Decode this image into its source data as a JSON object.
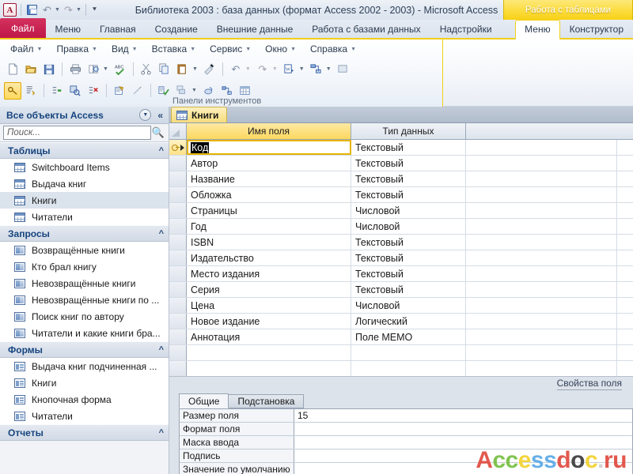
{
  "window": {
    "title": "Библиотека 2003 : база данных (формат Access 2002 - 2003)  -  Microsoft Access",
    "logo_text": "A"
  },
  "quick_access": {
    "items": [
      {
        "name": "save-icon",
        "label": ""
      },
      {
        "name": "undo-icon",
        "label": "↶"
      },
      {
        "name": "redo-icon",
        "label": "↷"
      },
      {
        "name": "customize-qat-icon",
        "label": "⯆"
      }
    ]
  },
  "ribbon": {
    "file_tab": "Файл",
    "tabs": [
      "Меню",
      "Главная",
      "Создание",
      "Внешние данные",
      "Работа с базами данных",
      "Надстройки"
    ],
    "contextual_group": "Работа с таблицами",
    "contextual_tabs": [
      {
        "label": "Меню",
        "active": true
      },
      {
        "label": "Конструктор",
        "active": false
      }
    ]
  },
  "legacy_menu": {
    "items": [
      "Файл",
      "Правка",
      "Вид",
      "Вставка",
      "Сервис",
      "Окно",
      "Справка"
    ],
    "panels_label": "Панели инструментов",
    "toolbar_row1": [
      "new-icon",
      "open-icon",
      "save-icon",
      "print-icon",
      "print-preview-icon",
      "spelling-icon",
      "cut-icon",
      "copy-icon",
      "paste-icon",
      "format-painter-icon",
      "undo-icon",
      "redo-icon",
      "office-links-icon",
      "relationships-icon",
      "more-icon"
    ],
    "toolbar_row2": [
      "primary-key-icon",
      "builder-icon",
      "insert-rows-icon",
      "indexes-icon",
      "delete-rows-icon",
      "properties-icon",
      "object-dependencies-icon",
      "test-validation-icon",
      "new-object-icon",
      "macro-icon",
      "relationships-small-icon",
      "datasheet-view-icon"
    ]
  },
  "nav_pane": {
    "header": "Все объекты Access",
    "search_placeholder": "Поиск...",
    "groups": [
      {
        "title": "Таблицы",
        "icon": "table-icon",
        "items": [
          {
            "label": "Switchboard Items",
            "selected": false
          },
          {
            "label": "Выдача книг",
            "selected": false
          },
          {
            "label": "Книги",
            "selected": true
          },
          {
            "label": "Читатели",
            "selected": false
          }
        ]
      },
      {
        "title": "Запросы",
        "icon": "query-icon",
        "items": [
          {
            "label": "Возвращённые книги",
            "selected": false
          },
          {
            "label": "Кто брал книгу",
            "selected": false
          },
          {
            "label": "Невозвращённые книги",
            "selected": false
          },
          {
            "label": "Невозвращённые книги по ...",
            "selected": false
          },
          {
            "label": "Поиск книг по автору",
            "selected": false
          },
          {
            "label": "Читатели и какие книги бра...",
            "selected": false
          }
        ]
      },
      {
        "title": "Формы",
        "icon": "form-icon",
        "items": [
          {
            "label": "Выдача книг подчиненная ...",
            "selected": false
          },
          {
            "label": "Книги",
            "selected": false
          },
          {
            "label": "Кнопочная форма",
            "selected": false
          },
          {
            "label": "Читатели",
            "selected": false
          }
        ]
      },
      {
        "title": "Отчеты",
        "icon": "report-icon",
        "items": []
      }
    ]
  },
  "document": {
    "tab_label": "Книги",
    "columns": [
      "Имя поля",
      "Тип данных",
      ""
    ],
    "rows": [
      {
        "name": "Код",
        "type": "Текстовый",
        "primary_key": true,
        "current": true
      },
      {
        "name": "Автор",
        "type": "Текстовый",
        "primary_key": false,
        "current": false
      },
      {
        "name": "Название",
        "type": "Текстовый",
        "primary_key": false,
        "current": false
      },
      {
        "name": "Обложка",
        "type": "Текстовый",
        "primary_key": false,
        "current": false
      },
      {
        "name": "Страницы",
        "type": "Числовой",
        "primary_key": false,
        "current": false
      },
      {
        "name": "Год",
        "type": "Числовой",
        "primary_key": false,
        "current": false
      },
      {
        "name": "ISBN",
        "type": "Текстовый",
        "primary_key": false,
        "current": false
      },
      {
        "name": "Издательство",
        "type": "Текстовый",
        "primary_key": false,
        "current": false
      },
      {
        "name": "Место издания",
        "type": "Текстовый",
        "primary_key": false,
        "current": false
      },
      {
        "name": "Серия",
        "type": "Текстовый",
        "primary_key": false,
        "current": false
      },
      {
        "name": "Цена",
        "type": "Числовой",
        "primary_key": false,
        "current": false
      },
      {
        "name": "Новое издание",
        "type": "Логический",
        "primary_key": false,
        "current": false
      },
      {
        "name": "Аннотация",
        "type": "Поле MEMO",
        "primary_key": false,
        "current": false
      },
      {
        "name": "",
        "type": "",
        "primary_key": false,
        "current": false
      },
      {
        "name": "",
        "type": "",
        "primary_key": false,
        "current": false
      },
      {
        "name": "",
        "type": "",
        "primary_key": false,
        "current": false
      }
    ]
  },
  "properties": {
    "panel_label": "Свойства поля",
    "tabs": [
      {
        "label": "Общие",
        "active": true
      },
      {
        "label": "Подстановка",
        "active": false
      }
    ],
    "rows": [
      {
        "name": "Размер поля",
        "value": "15"
      },
      {
        "name": "Формат поля",
        "value": ""
      },
      {
        "name": "Маска ввода",
        "value": ""
      },
      {
        "name": "Подпись",
        "value": ""
      },
      {
        "name": "Значение по умолчанию",
        "value": ""
      }
    ]
  },
  "watermark": {
    "letters": [
      {
        "ch": "A",
        "color": "#e04a3f"
      },
      {
        "ch": "c",
        "color": "#76c043"
      },
      {
        "ch": "c",
        "color": "#76c043"
      },
      {
        "ch": "e",
        "color": "#f2d22e"
      },
      {
        "ch": "s",
        "color": "#5aa9e6"
      },
      {
        "ch": "s",
        "color": "#5aa9e6"
      },
      {
        "ch": "d",
        "color": "#e04a3f"
      },
      {
        "ch": "o",
        "color": "#3b3b3b"
      },
      {
        "ch": "c",
        "color": "#f2d22e"
      },
      {
        "ch": ".",
        "color": "#d0d0d0"
      },
      {
        "ch": "r",
        "color": "#e04a3f"
      },
      {
        "ch": "u",
        "color": "#e04a3f"
      }
    ]
  }
}
